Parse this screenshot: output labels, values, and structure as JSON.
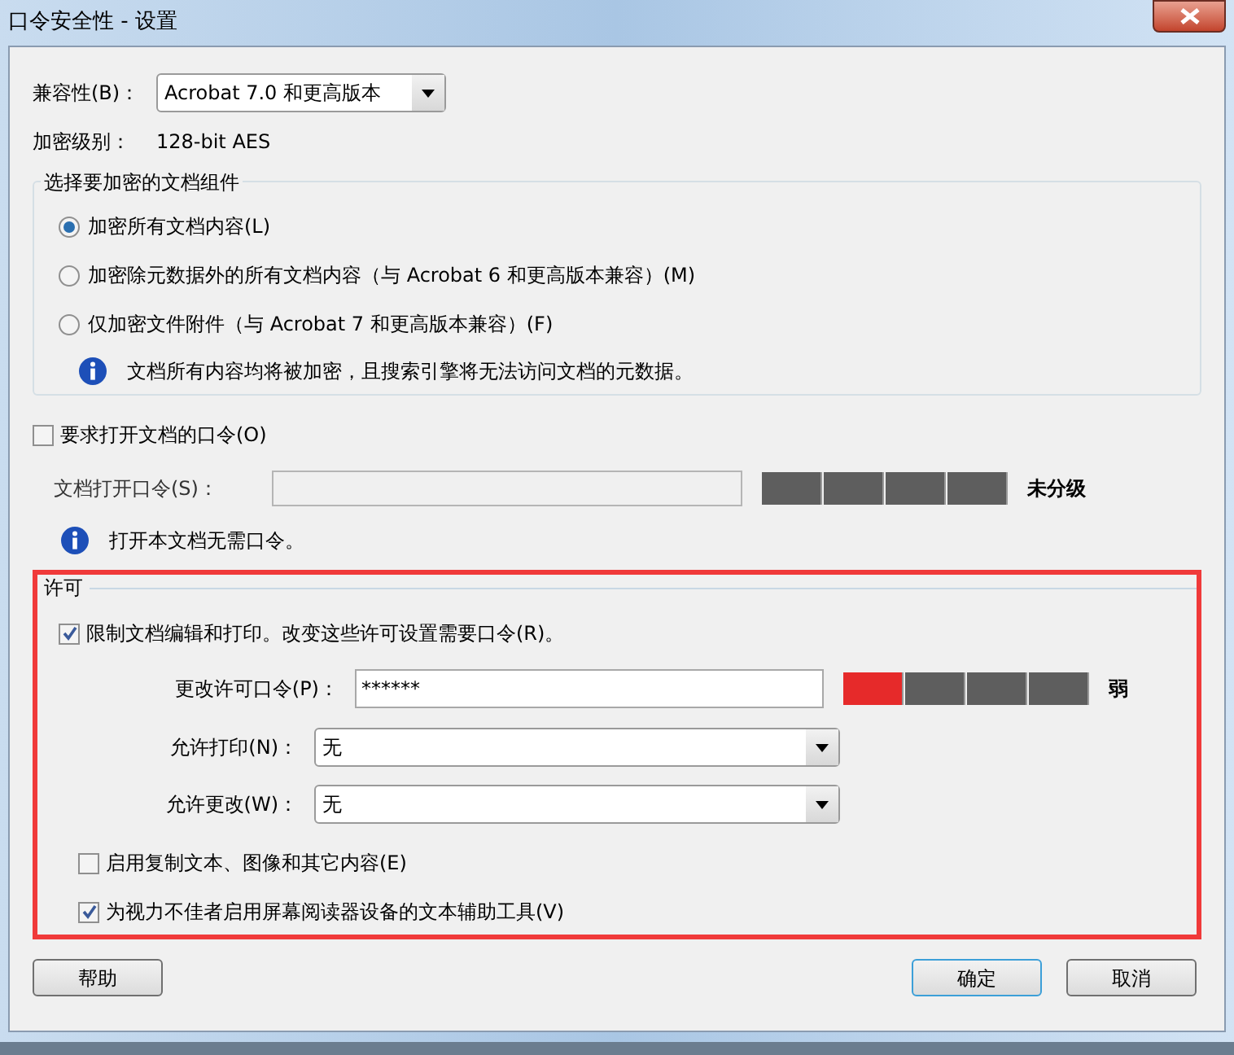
{
  "window": {
    "title": "口令安全性 - 设置"
  },
  "compatibility": {
    "label": "兼容性(B)：",
    "value": "Acrobat 7.0 和更高版本"
  },
  "encryption_level": {
    "label": "加密级别：",
    "value": "128-bit AES"
  },
  "components": {
    "title": "选择要加密的文档组件",
    "options": [
      {
        "label": "加密所有文档内容(L)",
        "selected": true
      },
      {
        "label": "加密除元数据外的所有文档内容（与 Acrobat 6 和更高版本兼容）(M)",
        "selected": false
      },
      {
        "label": "仅加密文件附件（与 Acrobat 7 和更高版本兼容）(F)",
        "selected": false
      }
    ],
    "info": "文档所有内容均将被加密，且搜索引擎将无法访问文档的元数据。"
  },
  "open_password": {
    "checkbox": {
      "label": "要求打开文档的口令(O)",
      "checked": false
    },
    "field_label": "文档打开口令(S)：",
    "disabled": true,
    "strength": {
      "segments": [
        {
          "on": false
        },
        {
          "on": false
        },
        {
          "on": false
        },
        {
          "on": false
        }
      ],
      "label": "未分级"
    },
    "info": "打开本文档无需口令。"
  },
  "permissions": {
    "title": "许可",
    "highlighted": true,
    "restrict": {
      "label": "限制文档编辑和打印。改变这些许可设置需要口令(R)。",
      "checked": true
    },
    "password": {
      "label": "更改许可口令(P)：",
      "value": "******",
      "strength": {
        "segments": [
          {
            "on": true
          },
          {
            "on": false
          },
          {
            "on": false
          },
          {
            "on": false
          }
        ],
        "label": "弱"
      }
    },
    "printing": {
      "label": "允许打印(N)：",
      "value": "无"
    },
    "changes": {
      "label": "允许更改(W)：",
      "value": "无"
    },
    "checkboxes": [
      {
        "label": "启用复制文本、图像和其它内容(E)",
        "checked": false
      },
      {
        "label": "为视力不佳者启用屏幕阅读器设备的文本辅助工具(V)",
        "checked": true
      }
    ]
  },
  "buttons": {
    "help": "帮助",
    "ok": "确定",
    "cancel": "取消"
  }
}
